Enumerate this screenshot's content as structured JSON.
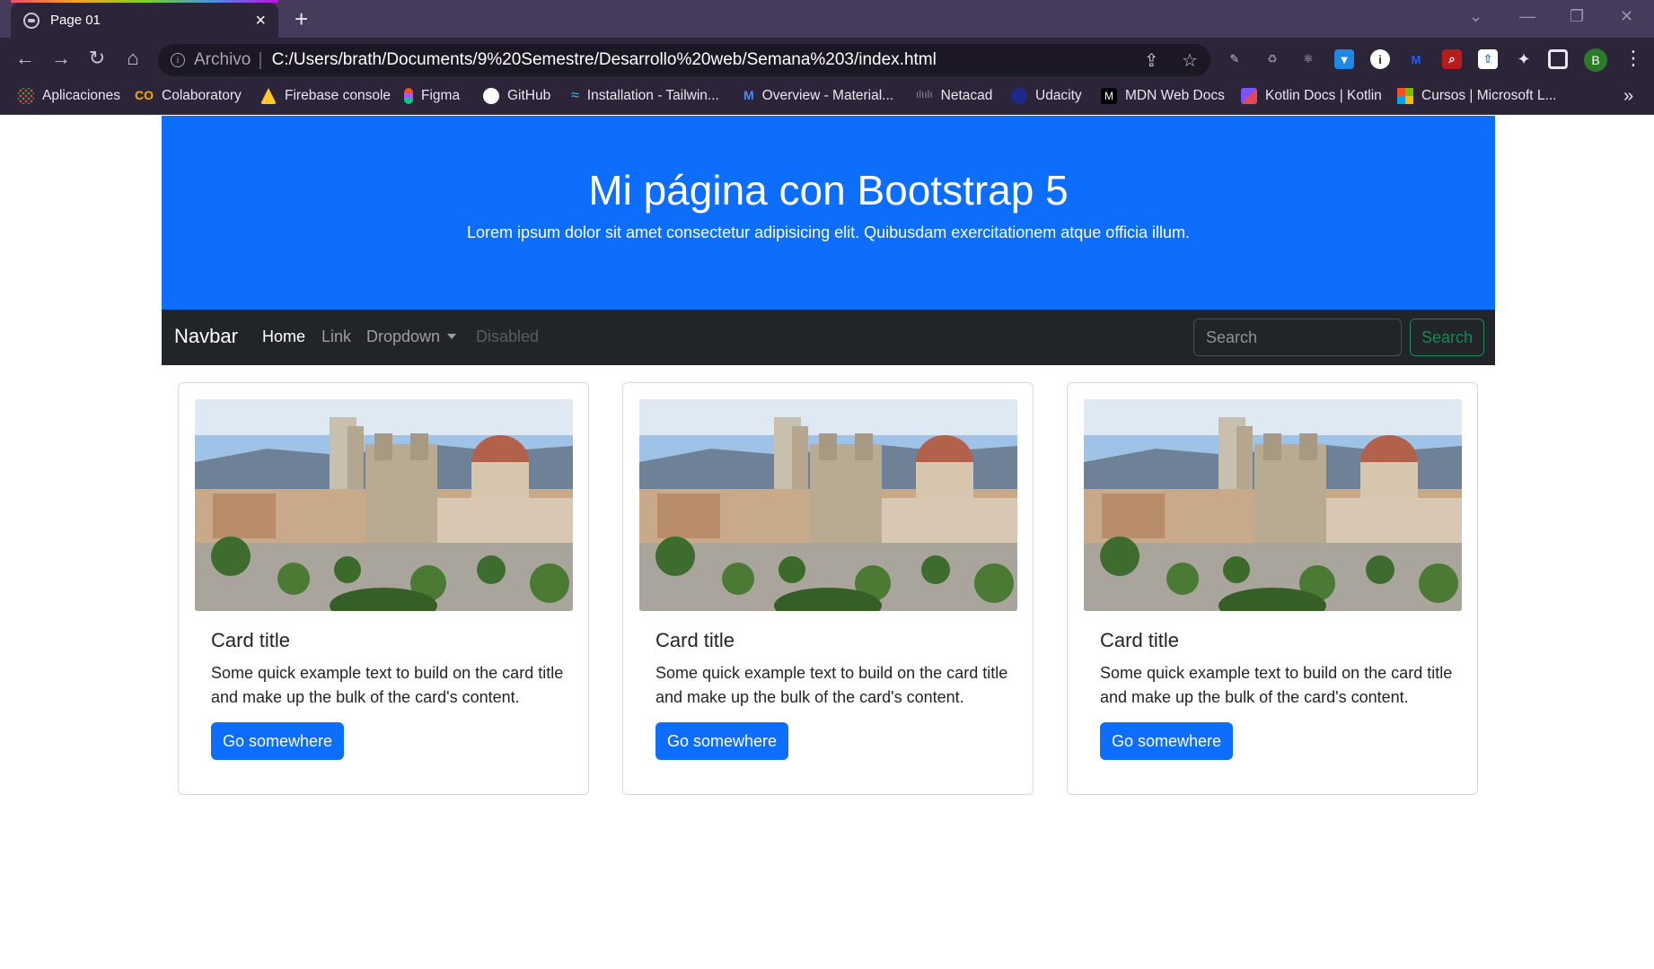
{
  "browser": {
    "tab": {
      "title": "Page 01"
    },
    "address": {
      "scheme": "Archivo",
      "url": "C:/Users/brath/Documents/9%20Semestre/Desarrollo%20web/Semana%203/index.html"
    },
    "profile_initial": "B",
    "bookmarks": [
      {
        "label": "Aplicaciones",
        "icon": "apps-grid-icon",
        "color": "#ea4335"
      },
      {
        "label": "Colaboratory",
        "icon": "colab-icon",
        "color": "#f9ab00"
      },
      {
        "label": "Firebase console",
        "icon": "firebase-icon",
        "color": "#ffca28"
      },
      {
        "label": "Figma",
        "icon": "figma-icon",
        "color": "#f24e1e"
      },
      {
        "label": "GitHub",
        "icon": "github-icon",
        "color": "#ffffff"
      },
      {
        "label": "Installation - Tailwin...",
        "icon": "tailwind-icon",
        "color": "#38bdf8"
      },
      {
        "label": "Overview - Material...",
        "icon": "material-icon",
        "color": "#448aff"
      },
      {
        "label": "Netacad",
        "icon": "cisco-icon",
        "color": "#6f6f6f"
      },
      {
        "label": "Udacity",
        "icon": "udacity-icon",
        "color": "#1e2a8a"
      },
      {
        "label": "MDN Web Docs",
        "icon": "mdn-icon",
        "color": "#000000"
      },
      {
        "label": "Kotlin Docs | Kotlin",
        "icon": "kotlin-icon",
        "color": "#7f52ff"
      },
      {
        "label": "Cursos | Microsoft L...",
        "icon": "microsoft-icon",
        "color": "#f25022"
      }
    ]
  },
  "hero": {
    "title": "Mi página con Bootstrap 5",
    "subtitle": "Lorem ipsum dolor sit amet consectetur adipisicing elit. Quibusdam exercitationem atque officia illum.",
    "bg_color": "#0d6efd"
  },
  "navbar": {
    "brand": "Navbar",
    "links": [
      "Home",
      "Link",
      "Dropdown",
      "Disabled"
    ],
    "search_placeholder": "Search",
    "search_button": "Search",
    "bg_color": "#212529"
  },
  "cards": [
    {
      "title": "Card title",
      "text": "Some quick example text to build on the card title and make up the bulk of the card's content.",
      "button": "Go somewhere"
    },
    {
      "title": "Card title",
      "text": "Some quick example text to build on the card title and make up the bulk of the card's content.",
      "button": "Go somewhere"
    },
    {
      "title": "Card title",
      "text": "Some quick example text to build on the card title and make up the bulk of the card's content.",
      "button": "Go somewhere"
    }
  ]
}
